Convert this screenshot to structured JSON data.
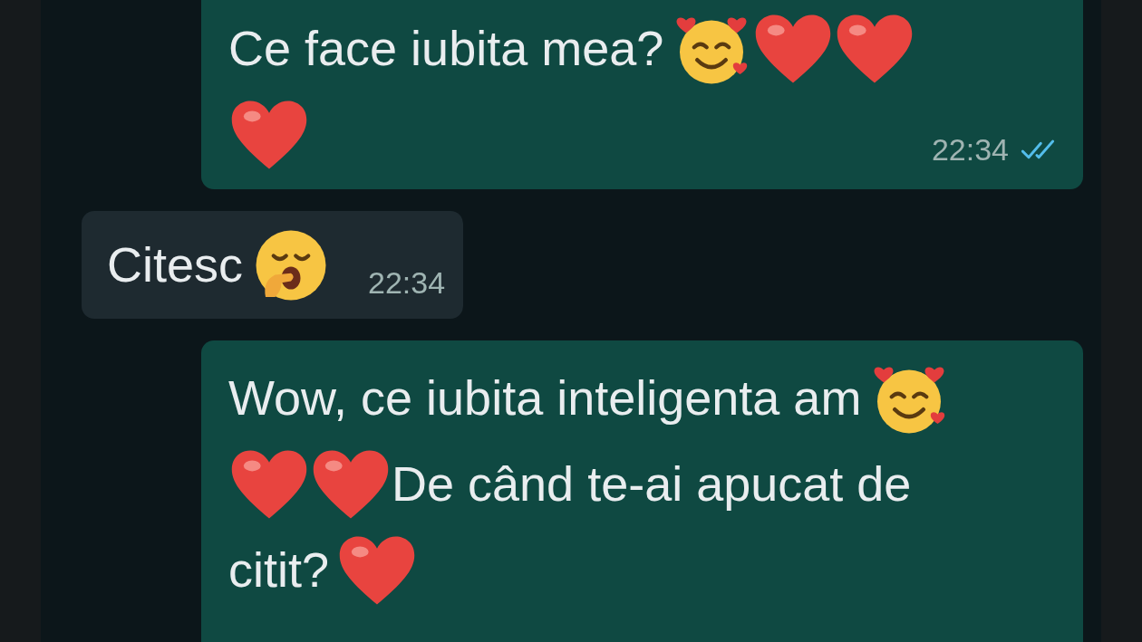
{
  "messages": [
    {
      "kind": "outgoing",
      "lines": [
        [
          {
            "kind": "text",
            "text": "Ce face iubita mea?"
          },
          {
            "kind": "smiling_hearts"
          },
          {
            "kind": "heart"
          },
          {
            "kind": "heart"
          }
        ],
        [
          {
            "kind": "heart"
          }
        ]
      ],
      "time": "22:34",
      "read": true
    },
    {
      "kind": "incoming",
      "lines": [
        [
          {
            "kind": "text",
            "text": "Citesc"
          },
          {
            "kind": "yawning"
          }
        ]
      ],
      "time": "22:34"
    },
    {
      "kind": "outgoing",
      "lines": [
        [
          {
            "kind": "text",
            "text": "Wow, ce iubita inteligenta am"
          },
          {
            "kind": "smiling_hearts"
          }
        ],
        [
          {
            "kind": "heart"
          },
          {
            "kind": "heart"
          },
          {
            "kind": "text",
            "text": "De când te-ai apucat de"
          }
        ],
        [
          {
            "kind": "text",
            "text": "citit?"
          },
          {
            "kind": "heart"
          }
        ]
      ]
    }
  ]
}
